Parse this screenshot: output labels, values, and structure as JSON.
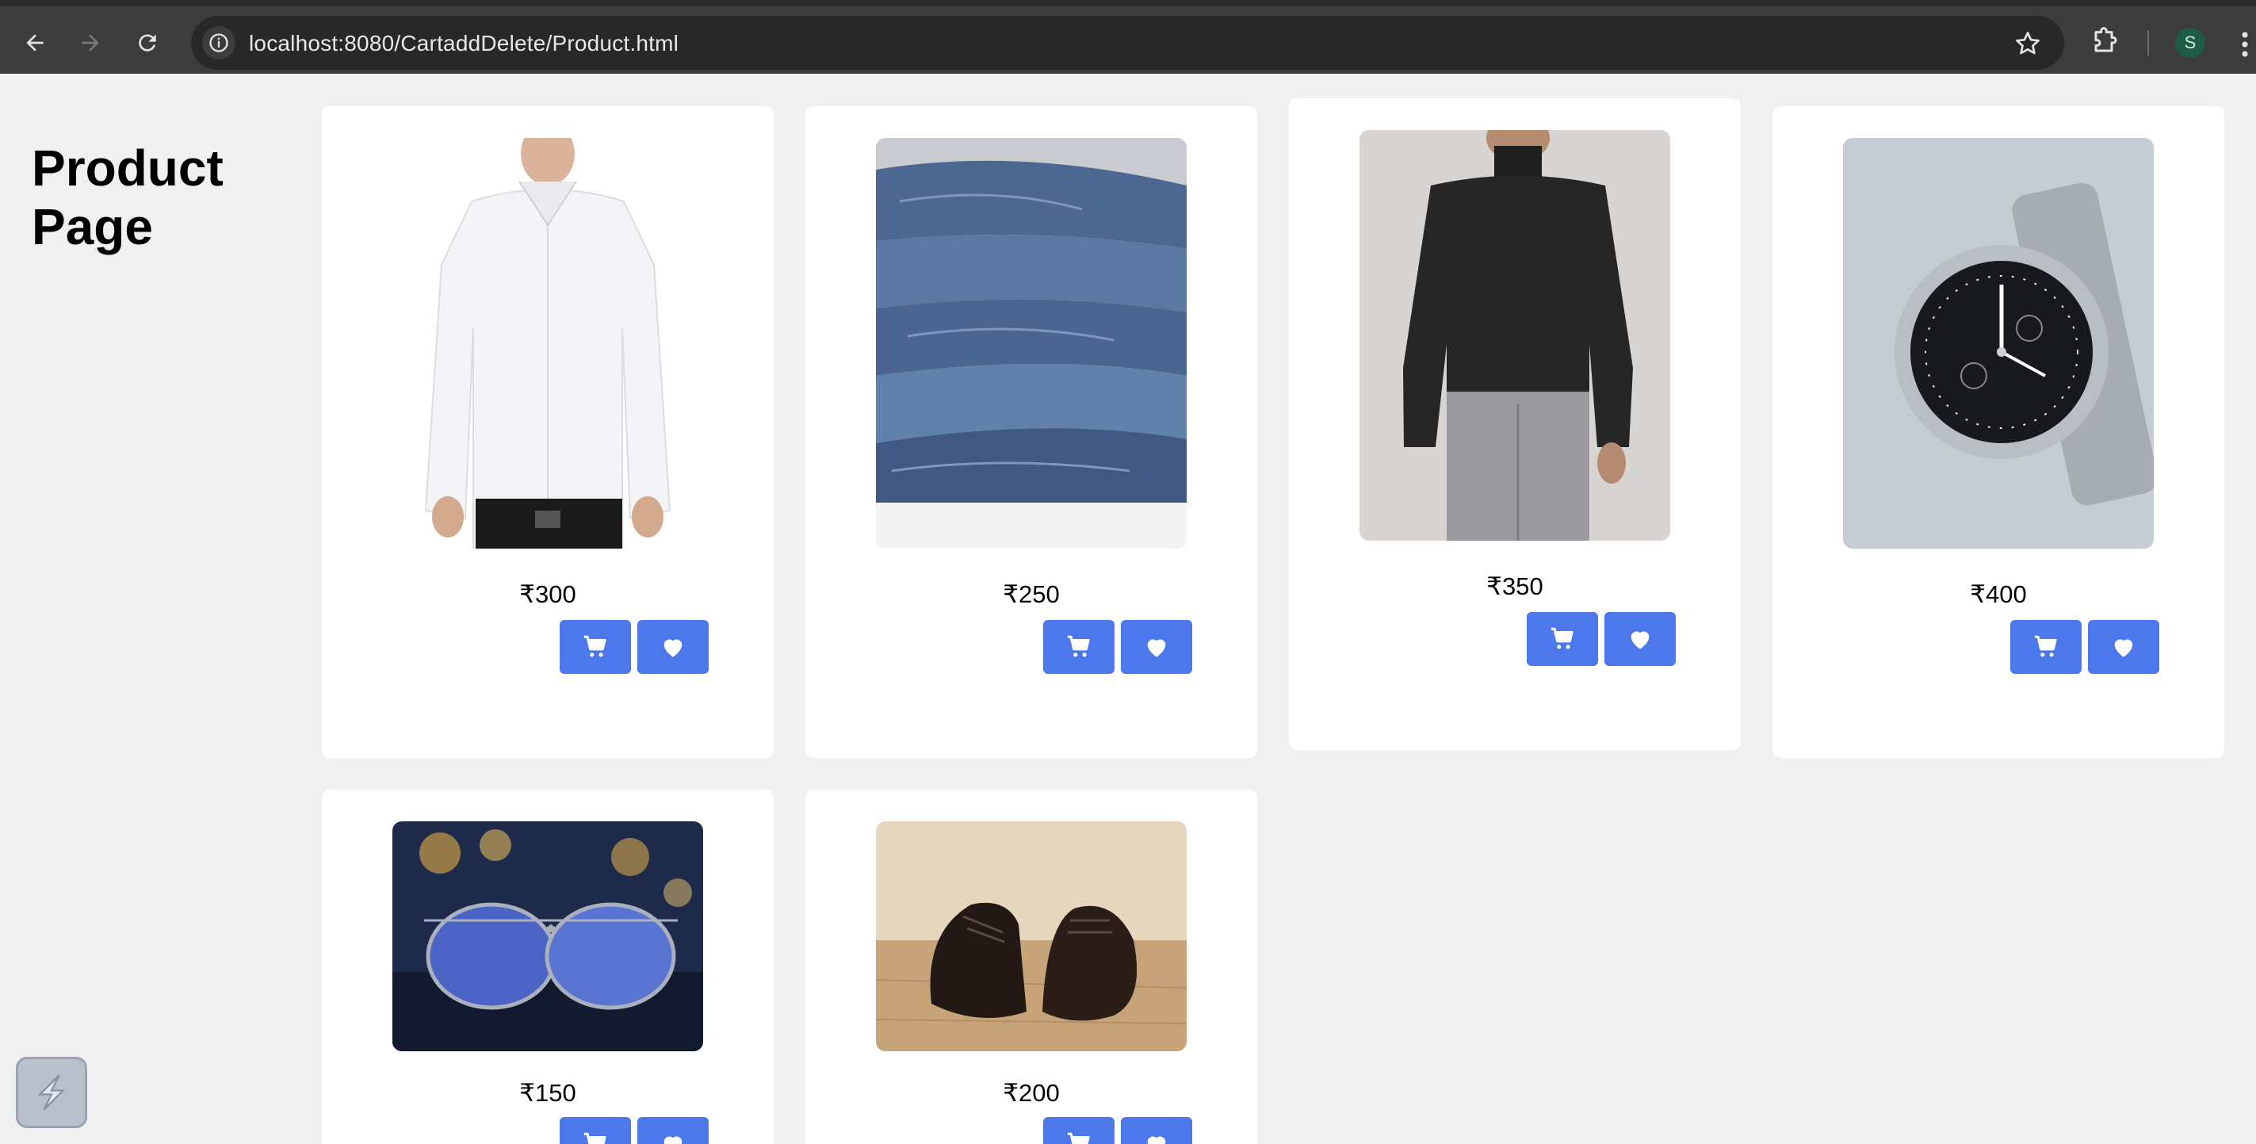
{
  "browser": {
    "url": "localhost:8080/CartaddDelete/Product.html",
    "profile_initial": "S"
  },
  "page": {
    "title": "Product Page"
  },
  "products": [
    {
      "name": "white-shirt",
      "price": "₹300"
    },
    {
      "name": "jeans",
      "price": "₹250"
    },
    {
      "name": "turtleneck",
      "price": "₹350"
    },
    {
      "name": "watch",
      "price": "₹400"
    },
    {
      "name": "sunglasses",
      "price": "₹150"
    },
    {
      "name": "shoes",
      "price": "₹200"
    }
  ],
  "icons": {
    "cart_button": "shopping-cart-icon",
    "wishlist_button": "heart-icon"
  },
  "colors": {
    "button": "#4c78ec",
    "background": "#f0f0f0",
    "card": "#ffffff"
  }
}
